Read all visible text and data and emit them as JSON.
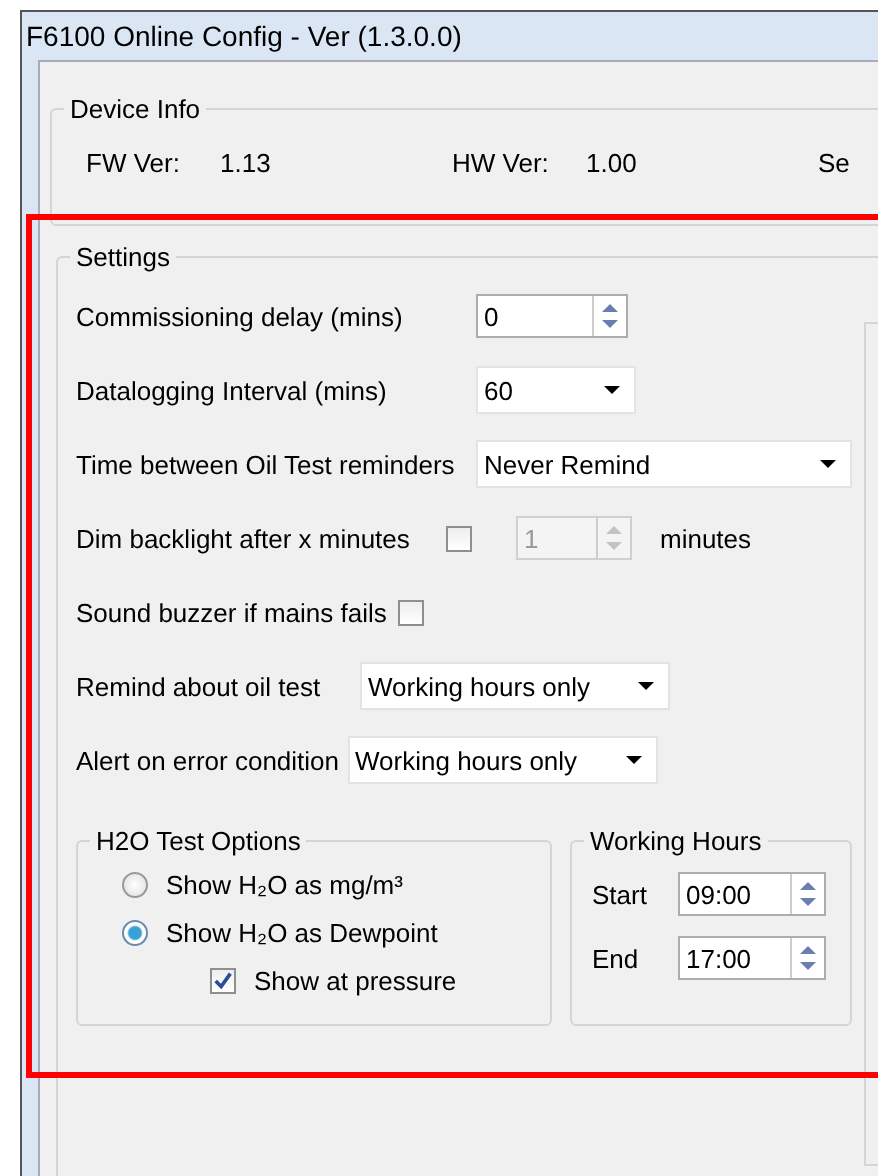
{
  "window": {
    "title": "F6100 Online Config - Ver (1.3.0.0)"
  },
  "device_info": {
    "title": "Device Info",
    "fields": [
      {
        "label": "FW Ver:",
        "value": "1.13"
      },
      {
        "label": "HW Ver:",
        "value": "1.00"
      },
      {
        "label": "Se"
      }
    ]
  },
  "settings": {
    "title": "Settings",
    "rows": [
      {
        "kind": "spinner",
        "label": "Commissioning delay (mins)",
        "value": "0"
      },
      {
        "kind": "dropdown",
        "label": "Datalogging Interval (mins)",
        "value": "60"
      },
      {
        "kind": "dropdown",
        "label": "Time between Oil Test reminders",
        "value": "Never Remind"
      },
      {
        "kind": "check-spinner",
        "label": "Dim backlight after x minutes",
        "checked": false,
        "value": "1",
        "disabled": true,
        "unit": "minutes"
      },
      {
        "kind": "checkbox",
        "label": "Sound buzzer if mains fails",
        "checked": false
      },
      {
        "kind": "dropdown",
        "label": "Remind about oil test",
        "value": "Working hours only"
      },
      {
        "kind": "dropdown",
        "label": "Alert on error condition",
        "value": "Working hours only"
      }
    ],
    "h2o": {
      "title": "H2O Test Options",
      "options": [
        {
          "label": "Show H₂O as mg/m³",
          "selected": false
        },
        {
          "label": "Show H₂O as Dewpoint",
          "selected": true
        }
      ],
      "pressure": {
        "label": "Show at pressure",
        "checked": true
      }
    },
    "working_hours": {
      "title": "Working Hours",
      "fields": [
        {
          "label": "Start",
          "value": "09:00"
        },
        {
          "label": "End",
          "value": "17:00"
        }
      ]
    }
  }
}
